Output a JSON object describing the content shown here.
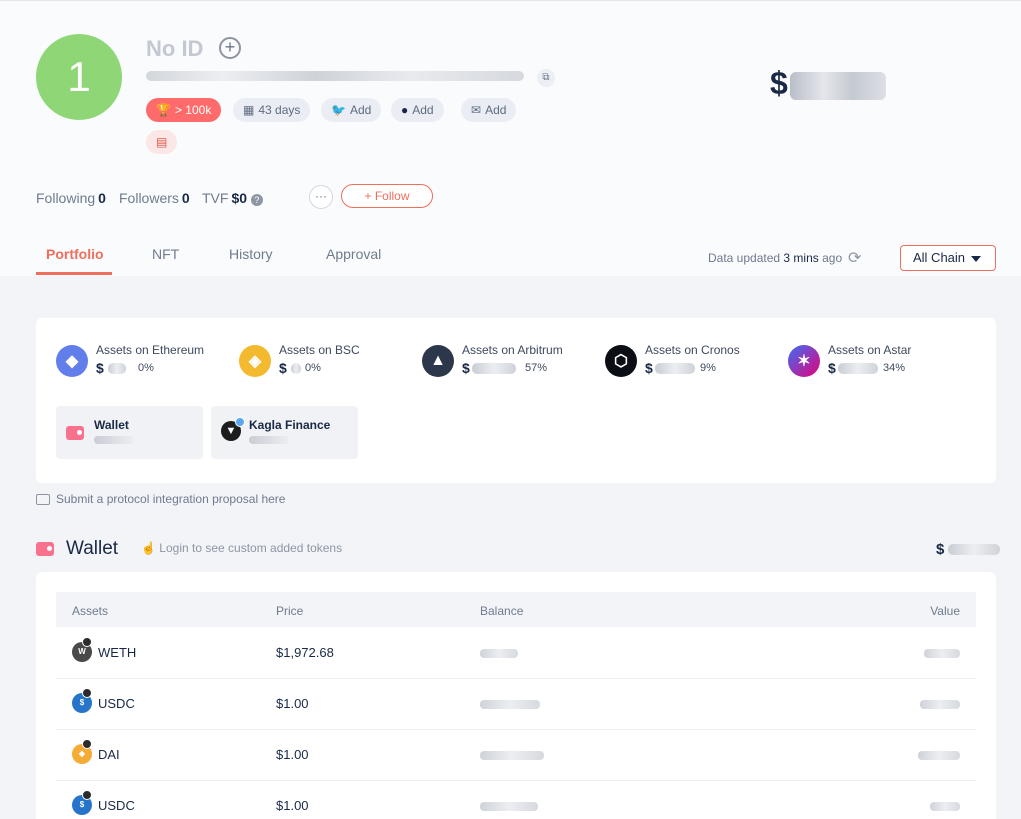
{
  "profile": {
    "avatar_label": "1",
    "name": "No ID",
    "total_prefix": "$",
    "tags": {
      "rank": "> 100k",
      "age": "43 days",
      "twitter": "Add",
      "github": "Add",
      "email": "Add"
    }
  },
  "stats": {
    "following_label": "Following",
    "following_value": "0",
    "followers_label": "Followers",
    "followers_value": "0",
    "tvf_label": "TVF",
    "tvf_value": "$0"
  },
  "actions": {
    "more": "···",
    "follow": "+ Follow"
  },
  "tabs": [
    {
      "label": "Portfolio",
      "active": true
    },
    {
      "label": "NFT"
    },
    {
      "label": "History"
    },
    {
      "label": "Approval"
    }
  ],
  "data_updated": {
    "prefix": "Data updated",
    "time": "3 mins",
    "suffix": "ago"
  },
  "chain_filter": {
    "selected": "All Chain"
  },
  "chains": [
    {
      "label": "Assets on Ethereum",
      "dollar": "$",
      "percent": "0%",
      "color": "#627eea",
      "icon": "ethereum-icon"
    },
    {
      "label": "Assets on BSC",
      "dollar": "$",
      "percent": "0%",
      "color": "#f3ba2f",
      "icon": "bsc-icon"
    },
    {
      "label": "Assets on Arbitrum",
      "dollar": "$",
      "percent": "57%",
      "color": "#2d374b",
      "icon": "arbitrum-icon"
    },
    {
      "label": "Assets on Cronos",
      "dollar": "$",
      "percent": "9%",
      "color": "#0b0e14",
      "icon": "cronos-icon"
    },
    {
      "label": "Assets on Astar",
      "dollar": "$",
      "percent": "34%",
      "color": "#3a6ff5",
      "icon": "astar-icon"
    }
  ],
  "protocols": [
    {
      "label": "Wallet"
    },
    {
      "label": "Kagla Finance"
    }
  ],
  "submit_proposal": "Submit a protocol integration proposal here",
  "wallet_section": {
    "title": "Wallet",
    "login_hint": "Login to see custom added tokens",
    "total_prefix": "$"
  },
  "token_table": {
    "headers": [
      "Assets",
      "Price",
      "Balance",
      "Value"
    ],
    "rows": [
      {
        "name": "WETH",
        "price": "$1,972.68",
        "color": "#4a4a4a"
      },
      {
        "name": "USDC",
        "price": "$1.00",
        "color": "#2775ca"
      },
      {
        "name": "DAI",
        "price": "$1.00",
        "color": "#f5ac37"
      },
      {
        "name": "USDC",
        "price": "$1.00",
        "color": "#2775ca"
      }
    ]
  },
  "colors": {
    "accent": "#ef6e5c",
    "avatar": "#8fd776",
    "rank_tag": "#ff6b6b",
    "wallet_icon": "#f9728d"
  }
}
